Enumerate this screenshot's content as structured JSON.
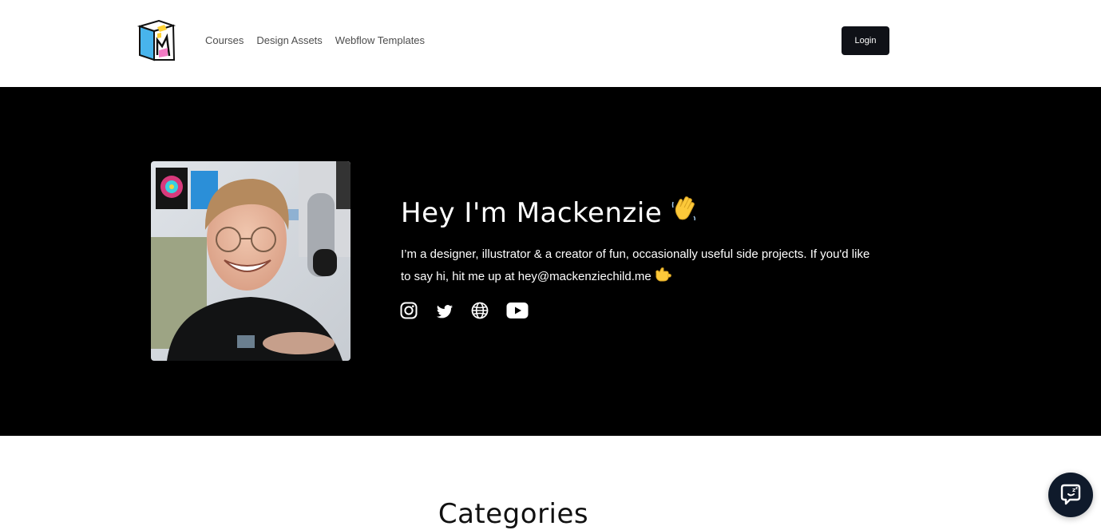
{
  "nav": {
    "links": [
      {
        "label": "Courses"
      },
      {
        "label": "Design Assets"
      },
      {
        "label": "Webflow Templates"
      }
    ],
    "login_label": "Login"
  },
  "hero": {
    "title": "Hey I'm Mackenzie",
    "title_emoji": "waving-hand-icon",
    "bio": "I’m a designer, illustrator & a creator of fun, occasionally useful side projects. If you'd like to say hi, hit me up at hey@mackenziechild.me",
    "bio_emoji": "call-me-hand-icon",
    "socials": [
      "instagram-icon",
      "twitter-icon",
      "globe-icon",
      "youtube-icon"
    ]
  },
  "section": {
    "title": "Categories"
  },
  "colors": {
    "hero_bg": "#000000",
    "button_bg": "#0f1117",
    "chat_bg": "#0f1a2b",
    "nav_text": "#4d4d4d"
  }
}
